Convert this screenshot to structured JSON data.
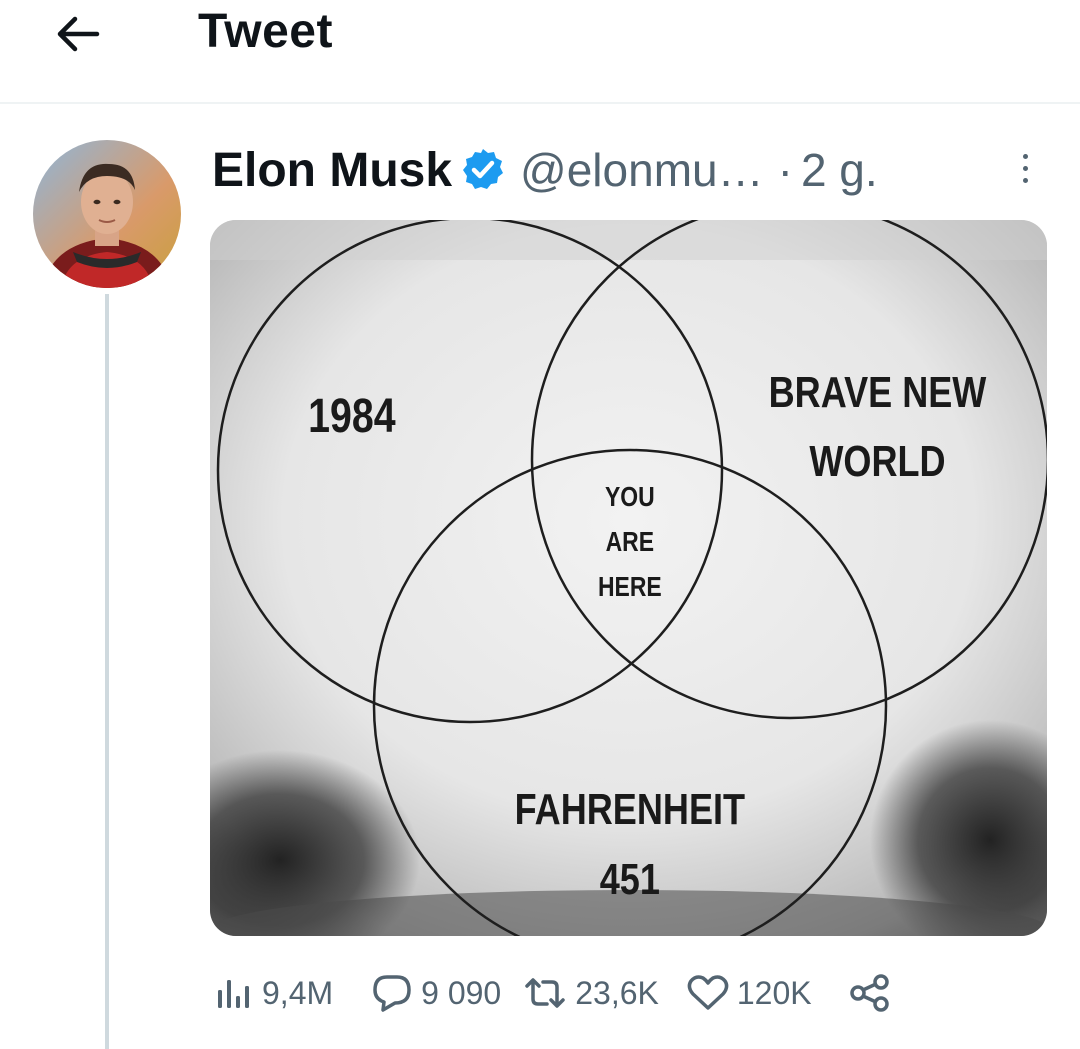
{
  "header": {
    "title": "Tweet",
    "back_icon": "arrow-left-icon"
  },
  "tweet": {
    "author": {
      "display_name": "Elon Musk",
      "handle": "@elonmu…",
      "verified": true
    },
    "separator": "·",
    "time": "2 g.",
    "media": {
      "labels": {
        "circle_a": "1984",
        "circle_b_line1": "BRAVE NEW",
        "circle_b_line2": "WORLD",
        "center_line1": "YOU",
        "center_line2": "ARE",
        "center_line3": "HERE",
        "circle_c_line1": "FAHRENHEIT",
        "circle_c_line2": "451"
      }
    },
    "stats": {
      "views": "9,4M",
      "replies": "9 090",
      "retweets": "23,6K",
      "likes": "120K"
    }
  },
  "colors": {
    "text_primary": "#0f1419",
    "text_secondary": "#536471",
    "verified_blue": "#1d9bf0",
    "divider": "#eff3f4",
    "thread_line": "#cfd9de"
  }
}
